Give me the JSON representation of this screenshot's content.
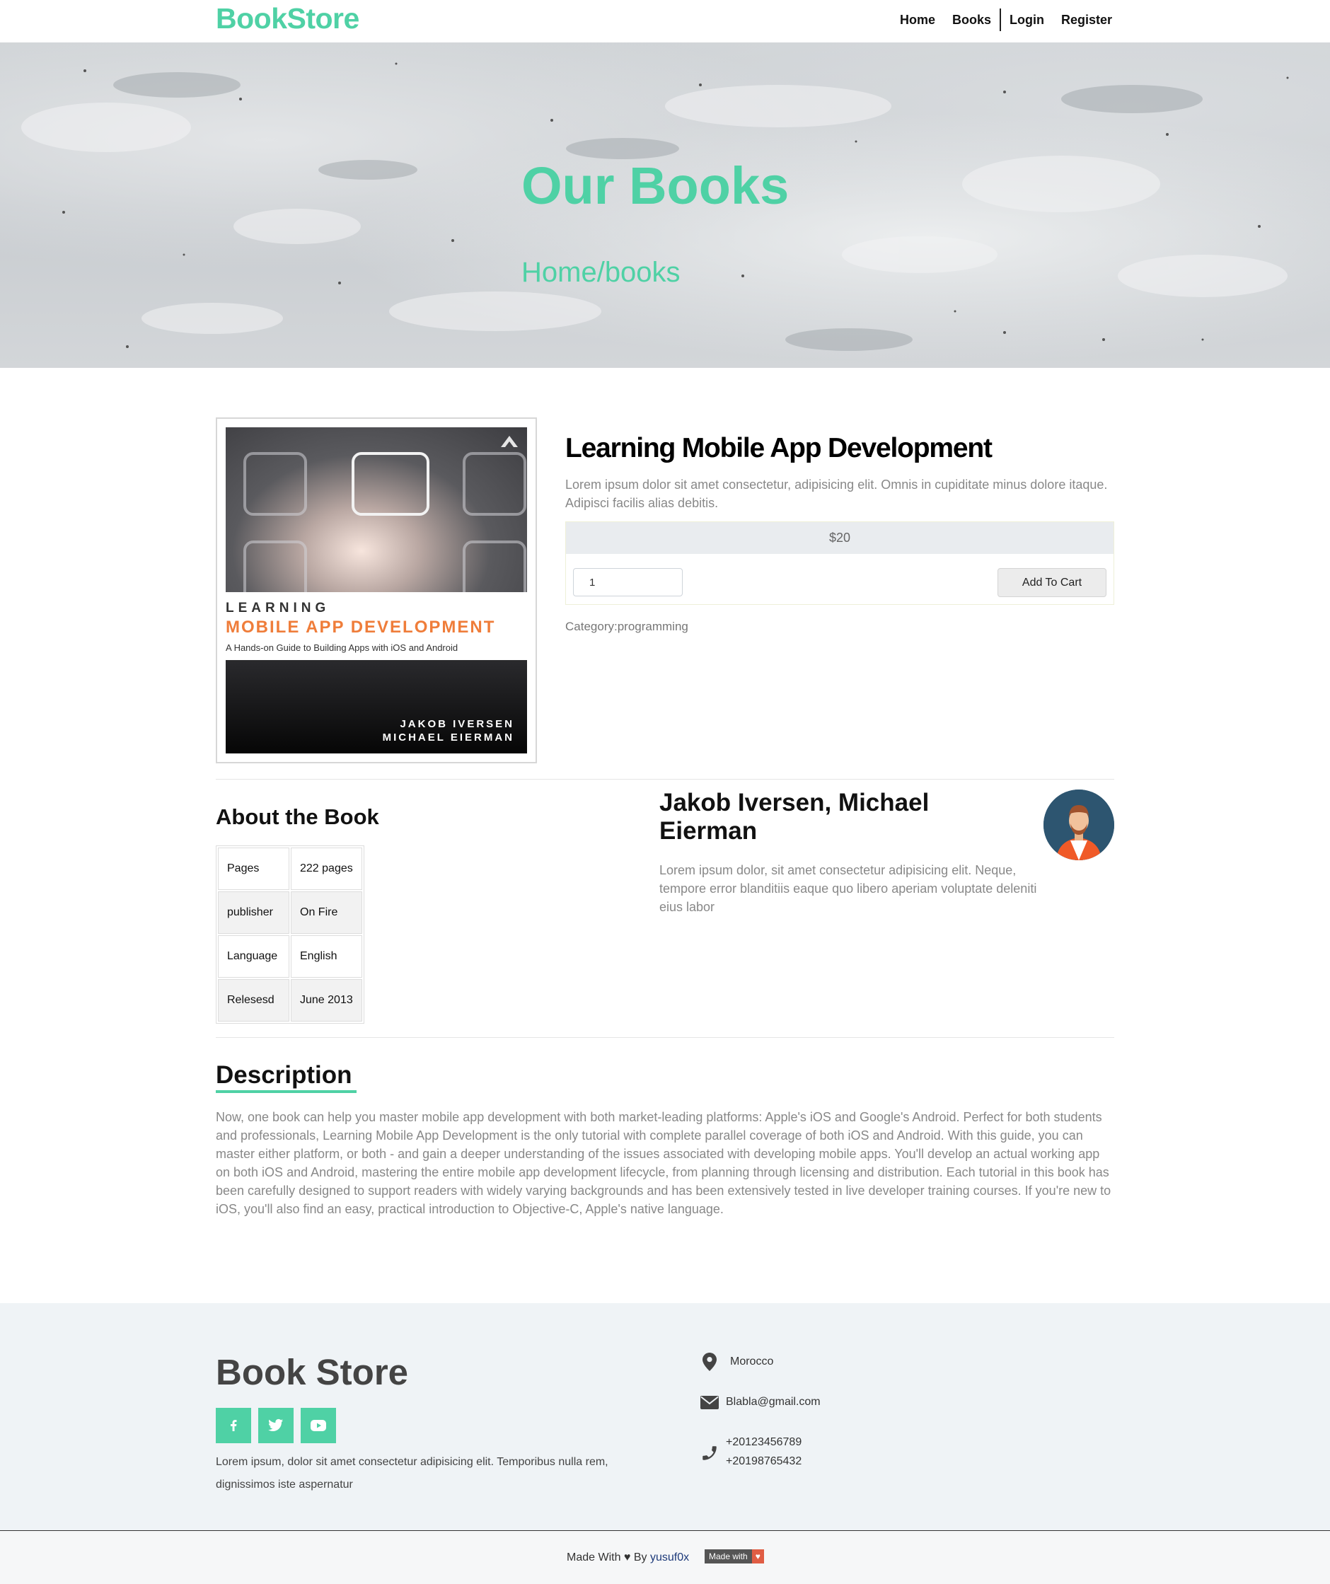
{
  "navbar": {
    "brand": "BookStore",
    "links": [
      "Home",
      "Books",
      "Login",
      "Register"
    ]
  },
  "hero": {
    "title": "Our Books",
    "breadcrumb": "Home/books"
  },
  "book": {
    "cover": {
      "line1": "LEARNING",
      "line2": "MOBILE APP DEVELOPMENT",
      "line3": "A Hands-on Guide to Building Apps with iOS and Android",
      "author1": "JAKOB IVERSEN",
      "author2": "MICHAEL EIERMAN"
    },
    "title": "Learning Mobile App Development",
    "short_description": "Lorem ipsum dolor sit amet consectetur, adipisicing elit. Omnis in cupiditate minus dolore itaque. Adipisci facilis alias debitis.",
    "price": "$20",
    "quantity": "1",
    "add_to_cart": "Add To Cart",
    "category": "Category:programming"
  },
  "about": {
    "title": "About the Book",
    "rows": [
      {
        "key": "Pages",
        "value": "222 pages"
      },
      {
        "key": "publisher",
        "value": "On Fire"
      },
      {
        "key": "Language",
        "value": "English"
      },
      {
        "key": "Relesesd",
        "value": "June 2013"
      }
    ]
  },
  "author": {
    "name": "Jakob Iversen, Michael Eierman",
    "bio": "Lorem ipsum dolor, sit amet consectetur adipisicing elit. Neque, tempore error blanditiis eaque quo libero aperiam voluptate deleniti eius labor"
  },
  "description": {
    "title": "Description",
    "text": "Now, one book can help you master mobile app development with both market-leading platforms: Apple's iOS and Google's Android. Perfect for both students and professionals, Learning Mobile App Development is the only tutorial with complete parallel coverage of both iOS and Android. With this guide, you can master either platform, or both - and gain a deeper understanding of the issues associated with developing mobile apps. You'll develop an actual working app on both iOS and Android, mastering the entire mobile app development lifecycle, from planning through licensing and distribution. Each tutorial in this book has been carefully designed to support readers with widely varying backgrounds and has been extensively tested in live developer training courses. If you're new to iOS, you'll also find an easy, practical introduction to Objective-C, Apple's native language."
  },
  "footer": {
    "brand": "Book Store",
    "about": "Lorem ipsum, dolor sit amet consectetur adipisicing elit. Temporibus nulla rem, dignissimos iste aspernatur",
    "social": [
      "facebook-icon",
      "twitter-icon",
      "youtube-icon"
    ],
    "location": "Morocco",
    "email": "Blabla@gmail.com",
    "phone1": "+20123456789",
    "phone2": "+20198765432",
    "made_with": "Made With ♥ By",
    "made_author": "yusuf0x",
    "badge_left": "Made with",
    "badge_right": "♥"
  },
  "colors": {
    "accent": "#4fd1a5",
    "footer_bg": "#eff3f6",
    "price_bg": "#e9ecef"
  }
}
